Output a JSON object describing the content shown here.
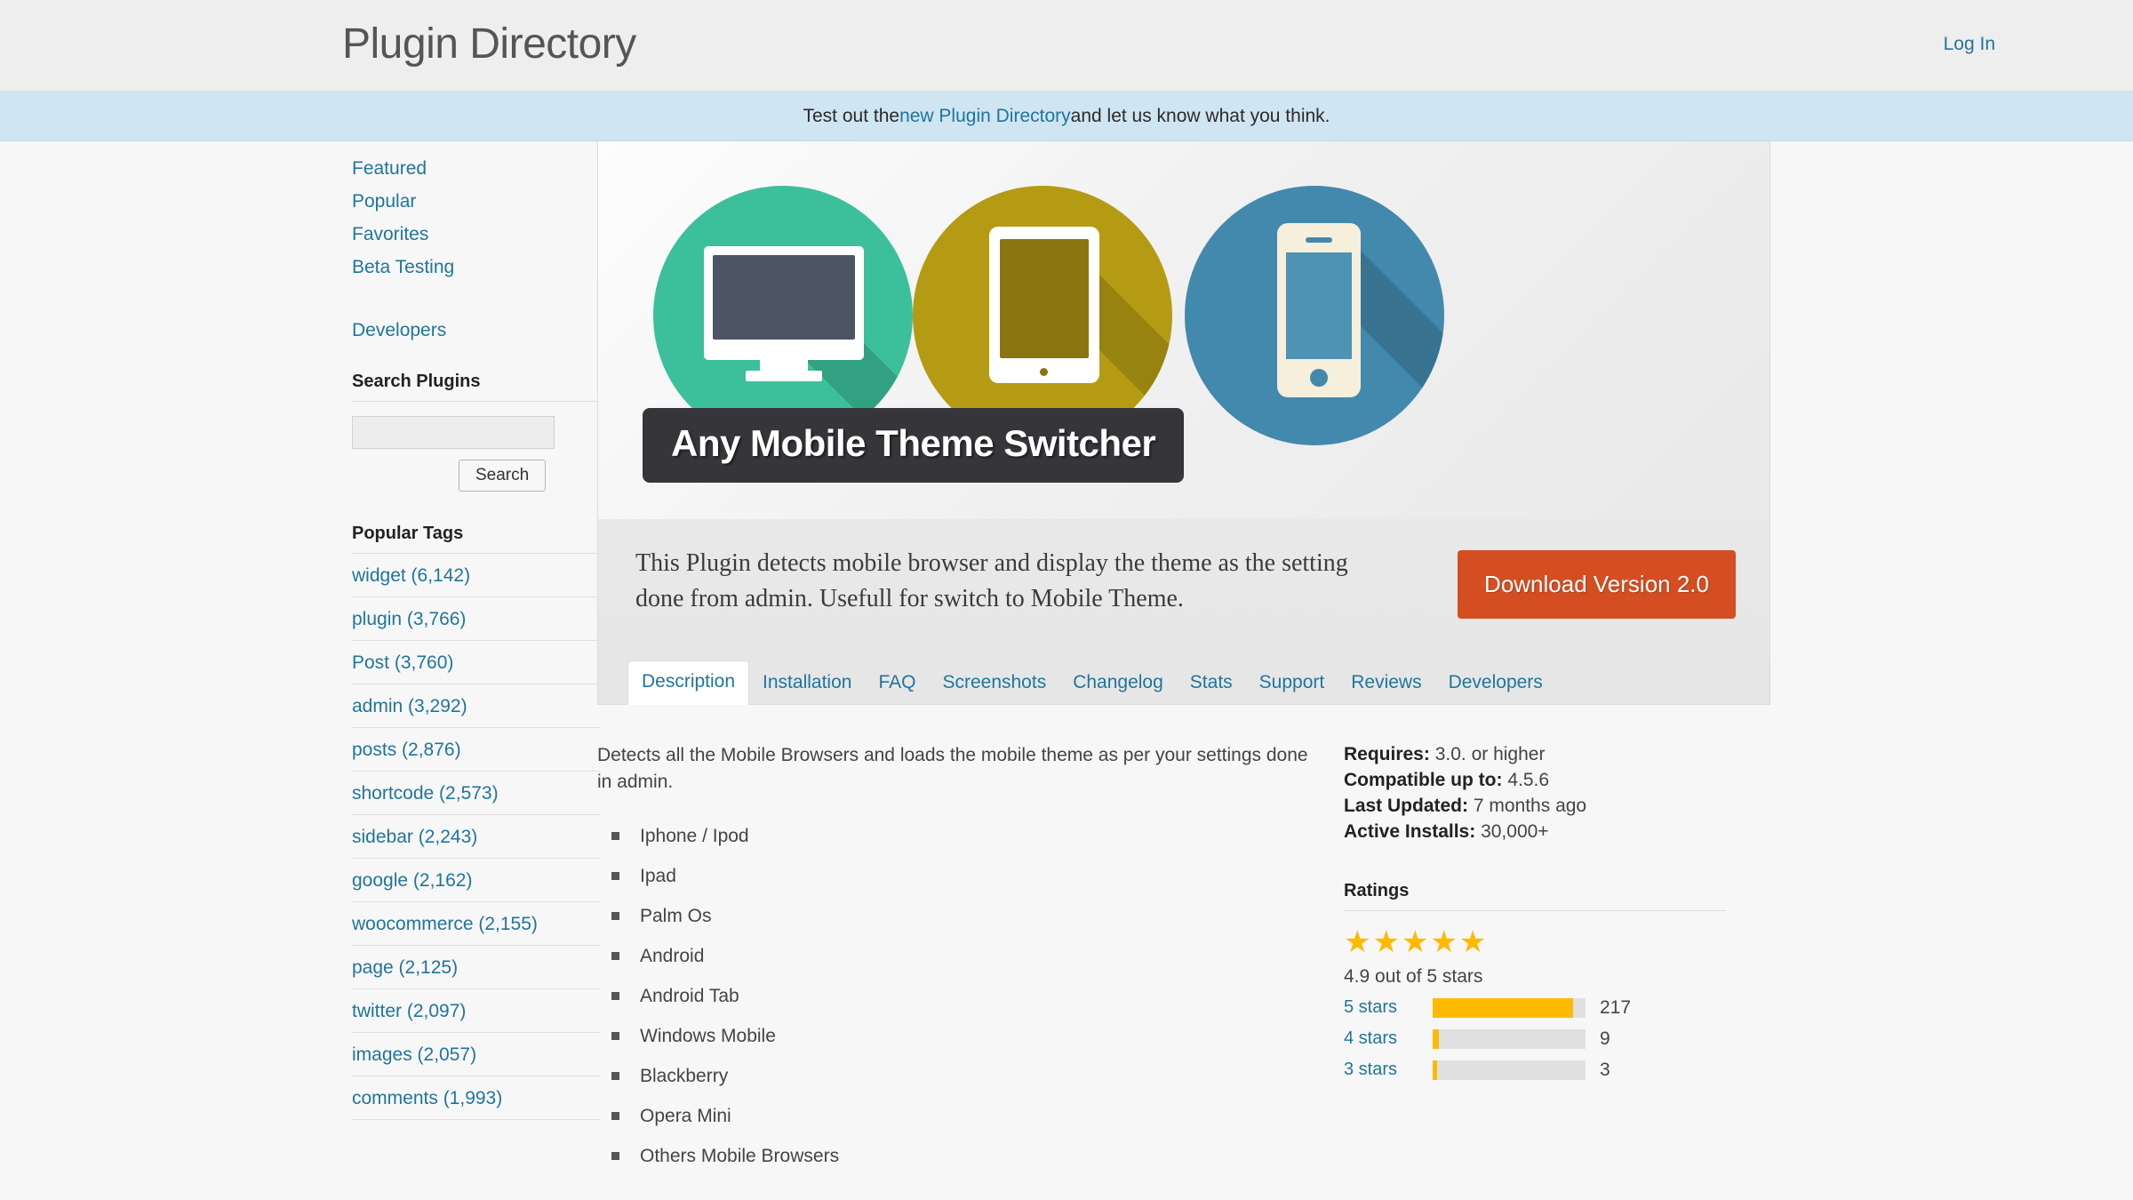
{
  "header": {
    "site_title": "Plugin Directory",
    "login_label": "Log In"
  },
  "notice": {
    "before": "Test out the ",
    "link": "new Plugin Directory",
    "after": " and let us know what you think."
  },
  "sidebar": {
    "nav": [
      {
        "label": "Featured"
      },
      {
        "label": "Popular"
      },
      {
        "label": "Favorites"
      },
      {
        "label": "Beta Testing"
      },
      {
        "label": "Developers"
      }
    ],
    "search": {
      "heading": "Search Plugins",
      "value": "",
      "placeholder": "",
      "button_label": "Search"
    },
    "tags_heading": "Popular Tags",
    "tags": [
      {
        "label": "widget (6,142)"
      },
      {
        "label": "plugin (3,766)"
      },
      {
        "label": "Post (3,760)"
      },
      {
        "label": "admin (3,292)"
      },
      {
        "label": "posts (2,876)"
      },
      {
        "label": "shortcode (2,573)"
      },
      {
        "label": "sidebar (2,243)"
      },
      {
        "label": "google (2,162)"
      },
      {
        "label": "woocommerce (2,155)"
      },
      {
        "label": "page (2,125)"
      },
      {
        "label": "twitter (2,097)"
      },
      {
        "label": "images (2,057)"
      },
      {
        "label": "comments (1,993)"
      }
    ]
  },
  "plugin": {
    "banner_title": "Any Mobile Theme Switcher",
    "short_description": "This Plugin detects mobile browser and display the theme as the setting done from admin. Usefull for switch to Mobile Theme.",
    "download_label": "Download Version 2.0",
    "tabs": [
      {
        "label": "Description",
        "active": true
      },
      {
        "label": "Installation",
        "active": false
      },
      {
        "label": "FAQ",
        "active": false
      },
      {
        "label": "Screenshots",
        "active": false
      },
      {
        "label": "Changelog",
        "active": false
      },
      {
        "label": "Stats",
        "active": false
      },
      {
        "label": "Support",
        "active": false
      },
      {
        "label": "Reviews",
        "active": false
      },
      {
        "label": "Developers",
        "active": false
      }
    ],
    "description_paragraph": "Detects all the Mobile Browsers and loads the mobile theme as per your settings done in admin.",
    "features": [
      "Iphone / Ipod",
      "Ipad",
      "Palm Os",
      "Android",
      "Android Tab",
      "Windows Mobile",
      "Blackberry",
      "Opera Mini",
      "Others Mobile Browsers"
    ]
  },
  "info": {
    "requires_label": "Requires:",
    "requires_value": "3.0. or higher",
    "compatible_label": "Compatible up to:",
    "compatible_value": "4.5.6",
    "updated_label": "Last Updated:",
    "updated_value": "7 months ago",
    "installs_label": "Active Installs:",
    "installs_value": "30,000+"
  },
  "ratings": {
    "heading": "Ratings",
    "stars_glyphs": "★★★★★",
    "average_text": "4.9 out of 5 stars",
    "rows": [
      {
        "label": "5 stars",
        "count": "217",
        "percent": 92
      },
      {
        "label": "4 stars",
        "count": "9",
        "percent": 4
      },
      {
        "label": "3 stars",
        "count": "3",
        "percent": 3
      }
    ]
  },
  "colors": {
    "accent_link": "#21759b",
    "download_orange": "#d54e21",
    "star_gold": "#ffb900",
    "circle_teal": "#3cc09b",
    "circle_gold": "#b59b14",
    "circle_blue": "#4389ad",
    "notice_bg": "#cfe5f2"
  }
}
